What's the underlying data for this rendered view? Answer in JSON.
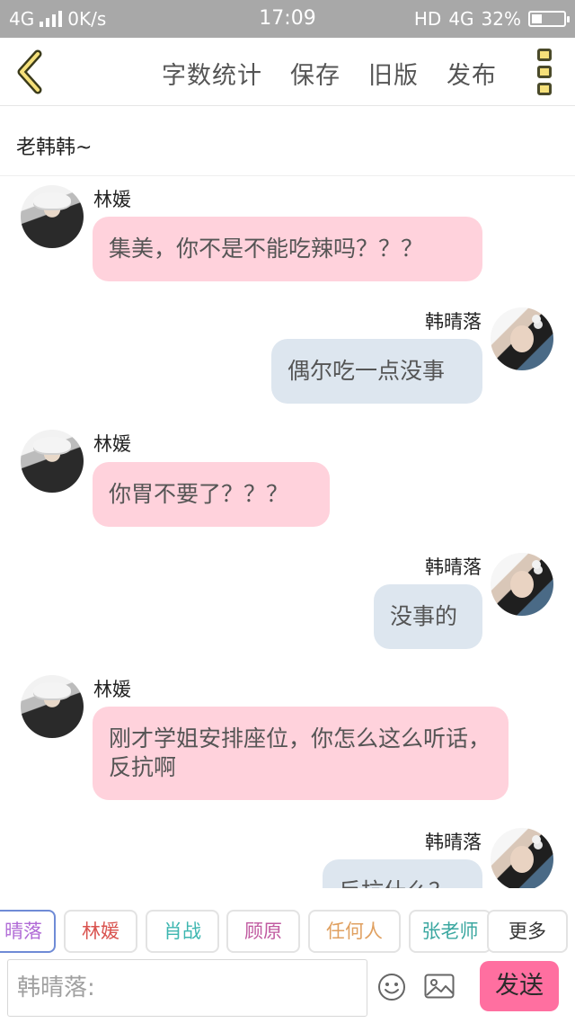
{
  "status_bar": {
    "network": "4G",
    "speed": "0K/s",
    "time": "17:09",
    "hd": "HD",
    "network_right": "4G",
    "battery": "32%",
    "battery_level": 0.32
  },
  "toolbar": {
    "back_icon": "chevron-left-icon",
    "actions": [
      "字数统计",
      "保存",
      "旧版",
      "发布"
    ],
    "menu_icon": "more-vertical-icon",
    "accent_color": "#f5e07a"
  },
  "chat_title": "老韩韩~",
  "messages": [
    {
      "side": "left",
      "name": "林媛",
      "text": "集美，你不是不能吃辣吗？？？"
    },
    {
      "side": "right",
      "name": "韩晴落",
      "text": "偶尔吃一点没事"
    },
    {
      "side": "left",
      "name": "林媛",
      "text": "你胃不要了？？？"
    },
    {
      "side": "right",
      "name": "韩晴落",
      "text": "没事的"
    },
    {
      "side": "left",
      "name": "林媛",
      "text": "刚才学姐安排座位，你怎么这么听话，反抗啊"
    },
    {
      "side": "right",
      "name": "韩晴落",
      "text": "反抗什么？"
    }
  ],
  "colors": {
    "left_bubble": "#ffd2dc",
    "right_bubble": "#dde6ef",
    "send_button": "#ff6fa0"
  },
  "chips": [
    {
      "label": "晴落",
      "color": "#b06ad6",
      "selected": true
    },
    {
      "label": "林媛",
      "color": "#d9534f"
    },
    {
      "label": "肖战",
      "color": "#3db6b0"
    },
    {
      "label": "顾原",
      "color": "#c05aa0"
    },
    {
      "label": "任何人",
      "color": "#e0a060"
    },
    {
      "label": "张老师",
      "color": "#3aa7a0"
    },
    {
      "label": "更多",
      "color": "#333333"
    }
  ],
  "input": {
    "placeholder": "韩晴落:",
    "emoji_icon": "emoji-icon",
    "image_icon": "image-icon",
    "send_label": "发送"
  }
}
